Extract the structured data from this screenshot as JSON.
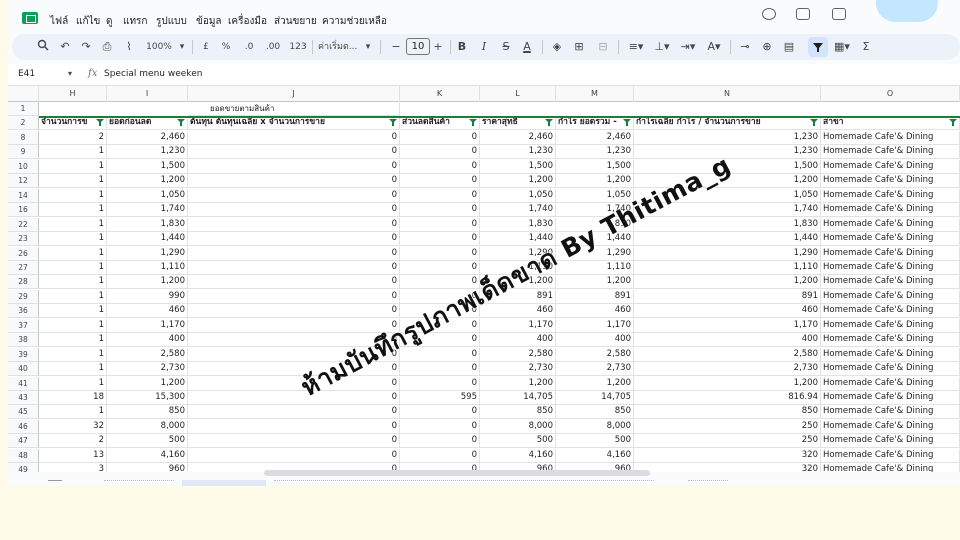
{
  "menu": [
    "ไฟล์",
    "แก้ไข",
    "ดู",
    "แทรก",
    "รูปแบบ",
    "ข้อมูล",
    "เครื่องมือ",
    "ส่วนขยาย",
    "ความช่วยเหลือ"
  ],
  "toolbar": {
    "zoom": "100%",
    "currency": "£",
    "percent": "%",
    "dec_less": ".0",
    "dec_more": ".00",
    "num_format": "123",
    "font_name": "ค่าเริ่มต...",
    "font_size": "10",
    "minus": "−",
    "plus": "+",
    "bold": "B",
    "italic": "I",
    "strike": "S",
    "text_color": "A",
    "sigma": "Σ"
  },
  "formula_bar": {
    "cell_ref": "E41",
    "fx": "fx",
    "content": "Special menu weeken"
  },
  "columns": [
    "H",
    "I",
    "J",
    "K",
    "L",
    "M",
    "N",
    "O"
  ],
  "row1": {
    "number": "1",
    "title": "ยอดขายตามสินค้า"
  },
  "header": {
    "number": "2",
    "labels": [
      "จำนวนการข",
      "ยอดก่อนลด",
      "ต้นทุน ต้นทุนเฉลี่ย x จำนวนการขาย",
      "ส่วนลดสินค้า",
      "ราคาสุทธิ",
      "กำไร ยอดรวม -",
      "กำไรเฉลี่ย กำไร / จำนวนการขาย",
      "สาขา"
    ]
  },
  "rows": [
    {
      "n": "8",
      "v": [
        "2",
        "2,460",
        "0",
        "0",
        "2,460",
        "2,460",
        "1,230",
        "Homemade Cafe'& Dining"
      ]
    },
    {
      "n": "9",
      "v": [
        "1",
        "1,230",
        "0",
        "0",
        "1,230",
        "1,230",
        "1,230",
        "Homemade Cafe'& Dining"
      ]
    },
    {
      "n": "10",
      "v": [
        "1",
        "1,500",
        "0",
        "0",
        "1,500",
        "1,500",
        "1,500",
        "Homemade Cafe'& Dining"
      ]
    },
    {
      "n": "12",
      "v": [
        "1",
        "1,200",
        "0",
        "0",
        "1,200",
        "1,200",
        "1,200",
        "Homemade Cafe'& Dining"
      ]
    },
    {
      "n": "14",
      "v": [
        "1",
        "1,050",
        "0",
        "0",
        "1,050",
        "1,050",
        "1,050",
        "Homemade Cafe'& Dining"
      ]
    },
    {
      "n": "16",
      "v": [
        "1",
        "1,740",
        "0",
        "0",
        "1,740",
        "1,740",
        "1,740",
        "Homemade Cafe'& Dining"
      ]
    },
    {
      "n": "22",
      "v": [
        "1",
        "1,830",
        "0",
        "0",
        "1,830",
        "1,830",
        "1,830",
        "Homemade Cafe'& Dining"
      ]
    },
    {
      "n": "23",
      "v": [
        "1",
        "1,440",
        "0",
        "0",
        "1,440",
        "1,440",
        "1,440",
        "Homemade Cafe'& Dining"
      ]
    },
    {
      "n": "26",
      "v": [
        "1",
        "1,290",
        "0",
        "0",
        "1,290",
        "1,290",
        "1,290",
        "Homemade Cafe'& Dining"
      ]
    },
    {
      "n": "27",
      "v": [
        "1",
        "1,110",
        "0",
        "0",
        "1,110",
        "1,110",
        "1,110",
        "Homemade Cafe'& Dining"
      ]
    },
    {
      "n": "28",
      "v": [
        "1",
        "1,200",
        "0",
        "0",
        "1,200",
        "1,200",
        "1,200",
        "Homemade Cafe'& Dining"
      ]
    },
    {
      "n": "29",
      "v": [
        "1",
        "990",
        "0",
        "0",
        "891",
        "891",
        "891",
        "Homemade Cafe'& Dining"
      ]
    },
    {
      "n": "36",
      "v": [
        "1",
        "460",
        "0",
        "0",
        "460",
        "460",
        "460",
        "Homemade Cafe'& Dining"
      ]
    },
    {
      "n": "37",
      "v": [
        "1",
        "1,170",
        "0",
        "0",
        "1,170",
        "1,170",
        "1,170",
        "Homemade Cafe'& Dining"
      ]
    },
    {
      "n": "38",
      "v": [
        "1",
        "400",
        "0",
        "0",
        "400",
        "400",
        "400",
        "Homemade Cafe'& Dining"
      ]
    },
    {
      "n": "39",
      "v": [
        "1",
        "2,580",
        "0",
        "0",
        "2,580",
        "2,580",
        "2,580",
        "Homemade Cafe'& Dining"
      ]
    },
    {
      "n": "40",
      "v": [
        "1",
        "2,730",
        "0",
        "0",
        "2,730",
        "2,730",
        "2,730",
        "Homemade Cafe'& Dining"
      ]
    },
    {
      "n": "41",
      "v": [
        "1",
        "1,200",
        "0",
        "0",
        "1,200",
        "1,200",
        "1,200",
        "Homemade Cafe'& Dining"
      ]
    },
    {
      "n": "43",
      "v": [
        "18",
        "15,300",
        "0",
        "595",
        "14,705",
        "14,705",
        "816.94",
        "Homemade Cafe'& Dining"
      ]
    },
    {
      "n": "45",
      "v": [
        "1",
        "850",
        "0",
        "0",
        "850",
        "850",
        "850",
        "Homemade Cafe'& Dining"
      ]
    },
    {
      "n": "46",
      "v": [
        "32",
        "8,000",
        "0",
        "0",
        "8,000",
        "8,000",
        "250",
        "Homemade Cafe'& Dining"
      ]
    },
    {
      "n": "47",
      "v": [
        "2",
        "500",
        "0",
        "0",
        "500",
        "500",
        "250",
        "Homemade Cafe'& Dining"
      ]
    },
    {
      "n": "48",
      "v": [
        "13",
        "4,160",
        "0",
        "0",
        "4,160",
        "4,160",
        "320",
        "Homemade Cafe'& Dining"
      ]
    },
    {
      "n": "49",
      "v": [
        "3",
        "960",
        "0",
        "0",
        "960",
        "960",
        "320",
        "Homemade Cafe'& Dining"
      ]
    }
  ],
  "watermark": "ห้ามบันทึกรูปภาพเด็ดขาด By Thitima_g",
  "colors": {
    "filter_green": "#188038",
    "toolbar_bg": "#edf2fa",
    "page_bg": "#fefce8"
  }
}
